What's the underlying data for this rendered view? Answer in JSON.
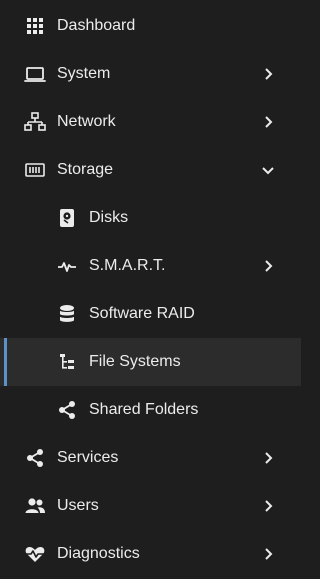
{
  "nav": {
    "active_color": "#5b93c7",
    "items": [
      {
        "label": "Dashboard",
        "icon": "grid-icon",
        "level": 0
      },
      {
        "label": "System",
        "icon": "laptop-icon",
        "level": 0,
        "chevron": "chevron-right"
      },
      {
        "label": "Network",
        "icon": "network-icon",
        "level": 0,
        "chevron": "chevron-right"
      },
      {
        "label": "Storage",
        "icon": "storage-icon",
        "level": 0,
        "chevron": "chevron-down",
        "expanded": true
      },
      {
        "label": "Disks",
        "icon": "disk-icon",
        "level": 1
      },
      {
        "label": "S.M.A.R.T.",
        "icon": "pulse-icon",
        "level": 1,
        "chevron": "chevron-right"
      },
      {
        "label": "Software RAID",
        "icon": "database-icon",
        "level": 1
      },
      {
        "label": "File Systems",
        "icon": "file-tree-icon",
        "level": 1,
        "active": true
      },
      {
        "label": "Shared Folders",
        "icon": "share-icon",
        "level": 1
      },
      {
        "label": "Services",
        "icon": "share-icon",
        "level": 0,
        "chevron": "chevron-right"
      },
      {
        "label": "Users",
        "icon": "users-icon",
        "level": 0,
        "chevron": "chevron-right"
      },
      {
        "label": "Diagnostics",
        "icon": "heart-pulse-icon",
        "level": 0,
        "chevron": "chevron-right"
      }
    ]
  }
}
